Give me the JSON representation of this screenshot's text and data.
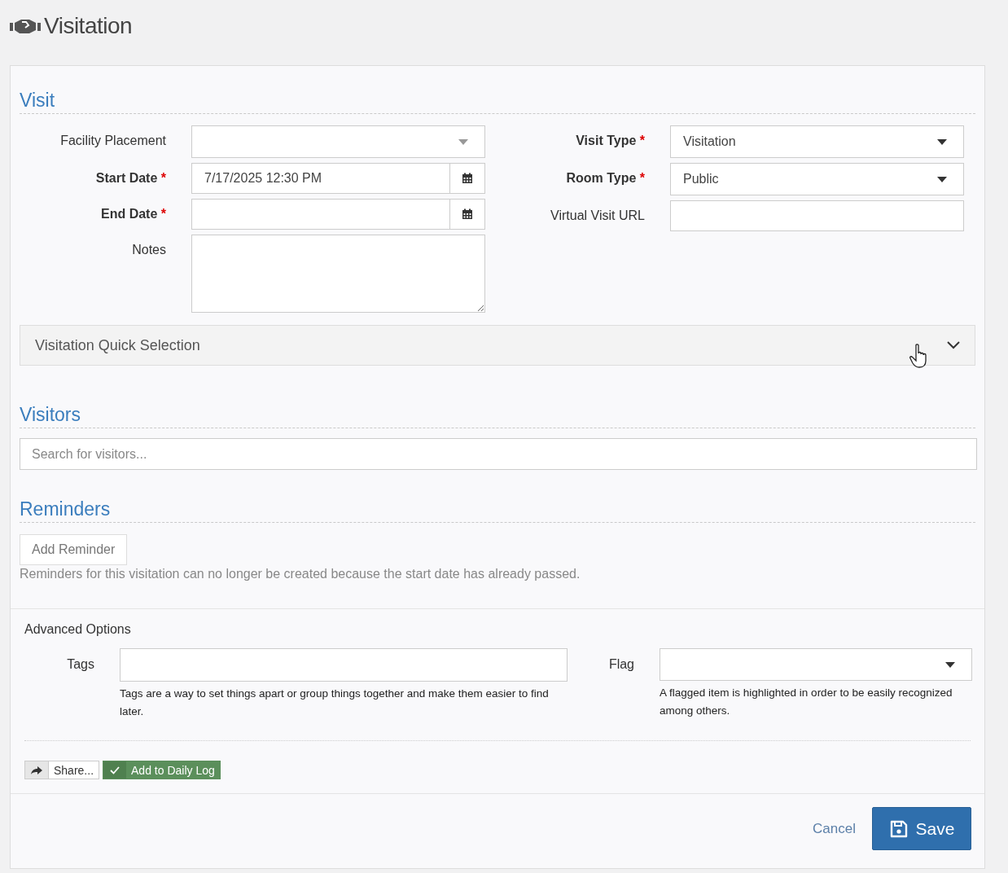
{
  "page": {
    "title": "Visitation"
  },
  "required_mark": "*",
  "visit": {
    "title": "Visit",
    "left_fields": [
      {
        "label": "Facility Placement",
        "kind": "select",
        "required": false
      },
      {
        "label": "Start Date",
        "kind": "datetime",
        "required": true,
        "value": "7/17/2025 12:30 PM"
      },
      {
        "label": "End Date",
        "kind": "datetime",
        "required": true
      },
      {
        "label": "Notes",
        "kind": "textarea",
        "required": false
      }
    ],
    "right_fields": [
      {
        "label": "Visit Type",
        "kind": "select",
        "required": true,
        "value": "Visitation"
      },
      {
        "label": "Room Type",
        "kind": "select",
        "required": true,
        "value": "Public"
      },
      {
        "label": "Virtual Visit URL",
        "kind": "text",
        "required": false
      }
    ]
  },
  "quick_selection": {
    "label": "Visitation Quick Selection",
    "expanded": false
  },
  "visitors": {
    "title": "Visitors",
    "search": {
      "placeholder": "Search for visitors..."
    }
  },
  "reminders": {
    "title": "Reminders",
    "add_button": "Add Reminder",
    "note": "Reminders for this visitation can no longer be created because the start date has already passed."
  },
  "advanced": {
    "title": "Advanced Options",
    "fields": [
      {
        "label": "Tags",
        "kind": "text",
        "help": "Tags are a way to set things apart or group things together and make them easier to find later."
      },
      {
        "label": "Flag",
        "kind": "select",
        "help": "A flagged item is highlighted in order to be easily recognized among others."
      }
    ]
  },
  "actions": [
    {
      "label": "Share...",
      "kind": "share"
    },
    {
      "label": "Add to Daily Log",
      "kind": "log"
    }
  ],
  "footer": {
    "cancel": "Cancel",
    "save": "Save"
  }
}
